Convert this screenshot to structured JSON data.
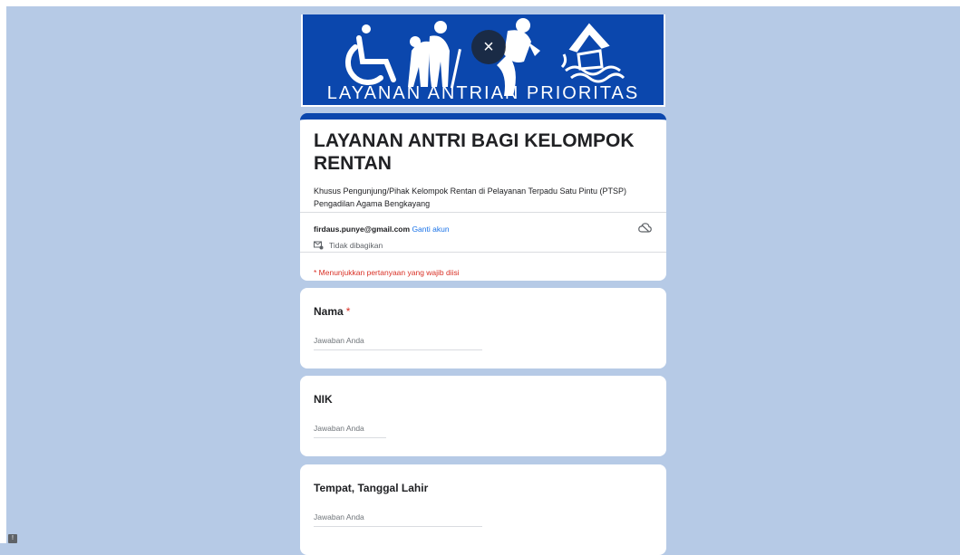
{
  "banner": {
    "text": "LAYANAN ANTRIAN PRIORITAS",
    "close_label": "×"
  },
  "header": {
    "title": "LAYANAN ANTRI BAGI KELOMPOK RENTAN",
    "description": "Khusus Pengunjung/Pihak Kelompok Rentan di Pelayanan Terpadu Satu Pintu (PTSP) Pengadilan Agama Bengkayang",
    "account_email": "firdaus.punye@gmail.com",
    "switch_account": "Ganti akun",
    "share_status": "Tidak dibagikan",
    "required_note": "* Menunjukkan pertanyaan yang wajib diisi"
  },
  "questions": [
    {
      "title": "Nama",
      "required_mark": "*",
      "placeholder": "Jawaban Anda"
    },
    {
      "title": "NIK",
      "placeholder": "Jawaban Anda"
    },
    {
      "title": "Tempat, Tanggal Lahir",
      "placeholder": "Jawaban Anda"
    }
  ],
  "feedback": {
    "label": "!"
  },
  "colors": {
    "background": "#b6cae6",
    "accent": "#0b47ad",
    "required": "#d93025",
    "link": "#1a73e8"
  }
}
